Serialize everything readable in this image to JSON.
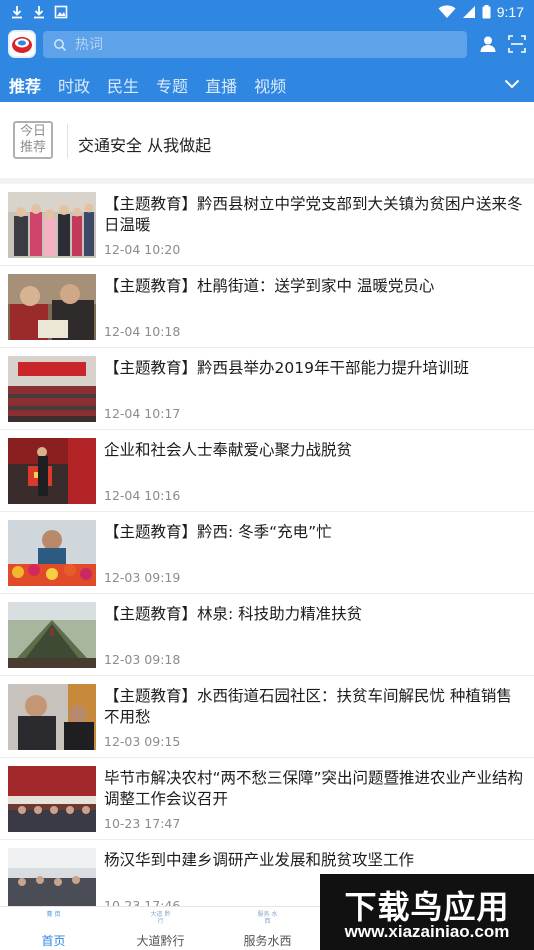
{
  "status_bar": {
    "time": "9:17",
    "left_icons": [
      "download-icon",
      "download-icon",
      "image-icon"
    ],
    "right_icons": [
      "wifi-icon",
      "signal-icon",
      "battery-icon"
    ]
  },
  "header": {
    "logo": "app-logo",
    "search_placeholder": "热词",
    "user_icon": "user-icon",
    "scan_icon": "scan-icon"
  },
  "tabs": [
    {
      "label": "推荐",
      "active": true
    },
    {
      "label": "时政",
      "active": false
    },
    {
      "label": "民生",
      "active": false
    },
    {
      "label": "专题",
      "active": false
    },
    {
      "label": "直播",
      "active": false
    },
    {
      "label": "视频",
      "active": false
    }
  ],
  "recommend": {
    "badge_line1": "今日",
    "badge_line2": "推荐",
    "title": "交通安全 从我做起"
  },
  "news": [
    {
      "title": "【主题教育】黔西县树立中学党支部到大关镇为贫困户送来冬日温暖",
      "time": "12-04 10:20"
    },
    {
      "title": "【主题教育】杜鹃街道：送学到家中 温暖党员心",
      "time": "12-04 10:18"
    },
    {
      "title": "【主题教育】黔西县举办2019年干部能力提升培训班",
      "time": "12-04 10:17"
    },
    {
      "title": "企业和社会人士奉献爱心聚力战脱贫",
      "time": "12-04 10:16"
    },
    {
      "title": "【主题教育】黔西: 冬季“充电”忙",
      "time": "12-03 09:19"
    },
    {
      "title": "【主题教育】林泉: 科技助力精准扶贫",
      "time": "12-03 09:18"
    },
    {
      "title": "【主题教育】水西街道石园社区：扶贫车间解民忧 种植销售不用愁",
      "time": "12-03 09:15"
    },
    {
      "title": "毕节市解决农村“两不愁三保障”突出问题暨推进农业产业结构调整工作会议召开",
      "time": "10-23 17:47"
    },
    {
      "title": "杨汉华到中建乡调研产业发展和脱贫攻坚工作",
      "time": "10-23 17:46"
    }
  ],
  "bottom_nav": [
    {
      "label": "首页",
      "icon_text": "育 页",
      "active": true
    },
    {
      "label": "大道黔行",
      "icon_text": "大道 黔行",
      "active": false
    },
    {
      "label": "服务水西",
      "icon_text": "服务 水西",
      "active": false
    }
  ],
  "watermark": {
    "main": "下载鸟应用",
    "sub": "www.xiazainiao.com"
  },
  "colors": {
    "brand": "#2f87e2",
    "search_bg": "#5ea2ea",
    "time_text": "#8c8c8c"
  }
}
